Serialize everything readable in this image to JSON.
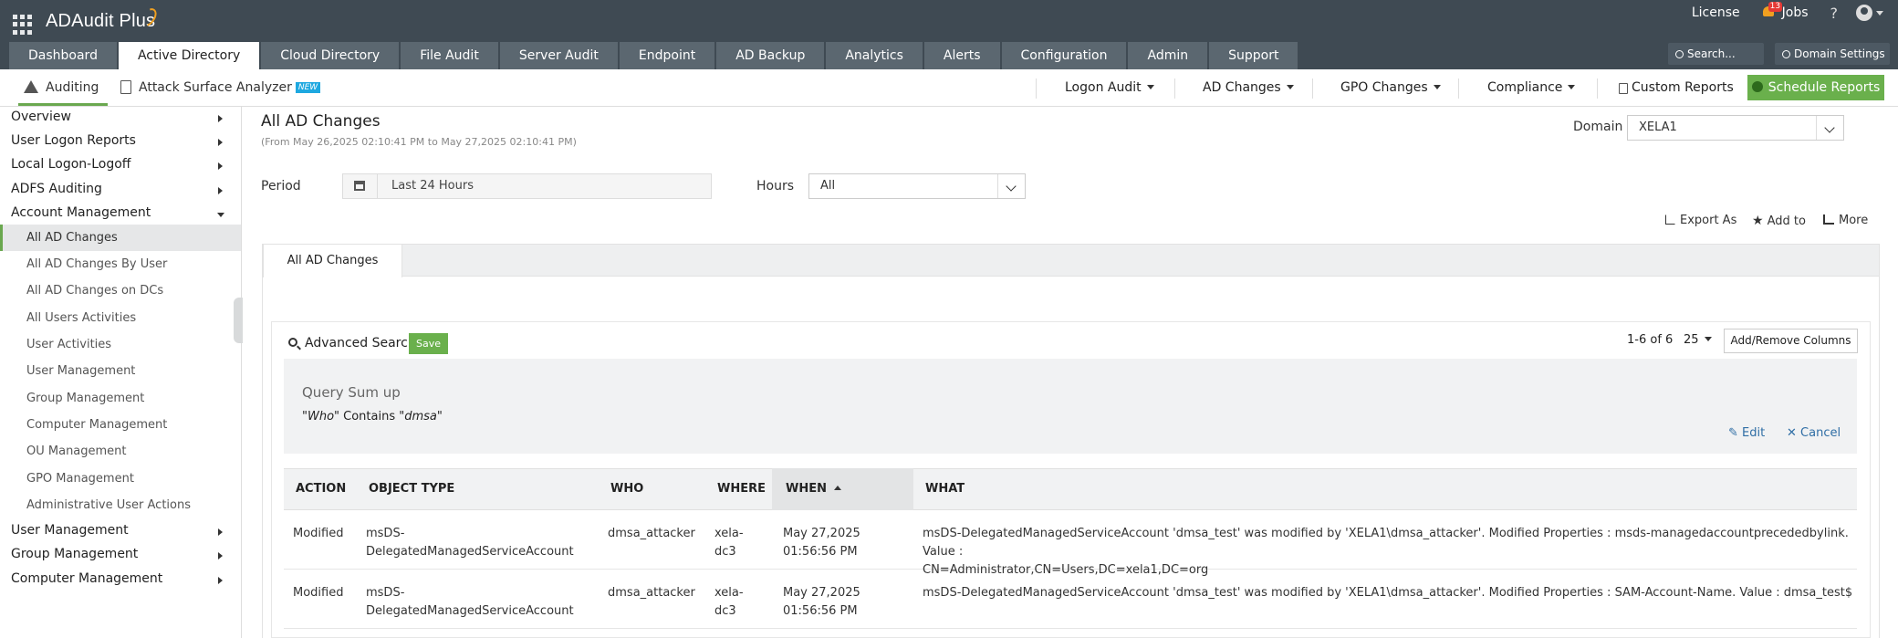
{
  "app": {
    "name": "ADAudit Plus",
    "license": "License",
    "jobs": "Jobs",
    "notification_count": "13",
    "help": "?"
  },
  "tabs": [
    "Dashboard",
    "Active Directory",
    "Cloud Directory",
    "File Audit",
    "Server Audit",
    "Endpoint",
    "AD Backup",
    "Analytics",
    "Alerts",
    "Configuration",
    "Admin",
    "Support"
  ],
  "search_placeholder": "Search...",
  "domain_settings": "Domain Settings",
  "subnav": {
    "auditing": "Auditing",
    "attack_surface": "Attack Surface Analyzer",
    "new_badge": "NEW",
    "logon_audit": "Logon Audit",
    "ad_changes": "AD Changes",
    "gpo_changes": "GPO Changes",
    "compliance": "Compliance",
    "custom_reports": "Custom Reports",
    "schedule_reports": "Schedule Reports"
  },
  "sidebar": {
    "top": [
      "Overview",
      "User Logon Reports",
      "Local Logon-Logoff",
      "ADFS Auditing"
    ],
    "open_group": "Account Management",
    "sub_items": [
      "All AD Changes",
      "All AD Changes By User",
      "All AD Changes on DCs",
      "All Users Activities",
      "User Activities",
      "User Management",
      "Group Management",
      "Computer Management",
      "OU Management",
      "GPO Management",
      "Administrative User Actions"
    ],
    "bottom": [
      "User Management",
      "Group Management",
      "Computer Management"
    ]
  },
  "report": {
    "title": "All AD Changes",
    "date_range": "(From May 26,2025 02:10:41 PM to May 27,2025 02:10:41 PM)",
    "domain_label": "Domain",
    "domain_value": "XELA1",
    "period_label": "Period",
    "period_value": "Last 24 Hours",
    "hours_label": "Hours",
    "hours_value": "All",
    "export": "Export As",
    "add_to": "Add to",
    "more": "More",
    "tab": "All AD Changes",
    "advanced_search": "Advanced Search",
    "save": "Save",
    "pager": "1-6 of 6",
    "per_page": "25",
    "add_remove_columns": "Add/Remove Columns",
    "query_title": "Query Sum up",
    "query_field": "\"Who\"",
    "query_op": " Contains ",
    "query_value": "\"dmsa\"",
    "edit": "Edit",
    "cancel": "Cancel"
  },
  "table": {
    "columns": [
      "ACTION",
      "OBJECT TYPE",
      "WHO",
      "WHERE",
      "WHEN",
      "WHAT"
    ],
    "rows": [
      {
        "action": "Modified",
        "object_type_1": "msDS-",
        "object_type_2": "DelegatedManagedServiceAccount",
        "who": "dmsa_attacker",
        "where_1": "xela-",
        "where_2": "dc3",
        "when_1": "May 27,2025",
        "when_2": "01:56:56 PM",
        "what_1": "msDS-DelegatedManagedServiceAccount 'dmsa_test' was modified by 'XELA1\\dmsa_attacker'. Modified Properties : msds-managedaccountprecededbylink. Value :",
        "what_2": "CN=Administrator,CN=Users,DC=xela1,DC=org"
      },
      {
        "action": "Modified",
        "object_type_1": "msDS-",
        "object_type_2": "DelegatedManagedServiceAccount",
        "who": "dmsa_attacker",
        "where_1": "xela-",
        "where_2": "dc3",
        "when_1": "May 27,2025",
        "when_2": "01:56:56 PM",
        "what_1": "msDS-DelegatedManagedServiceAccount 'dmsa_test' was modified by 'XELA1\\dmsa_attacker'. Modified Properties : SAM-Account-Name. Value : dmsa_test$",
        "what_2": ""
      }
    ]
  }
}
